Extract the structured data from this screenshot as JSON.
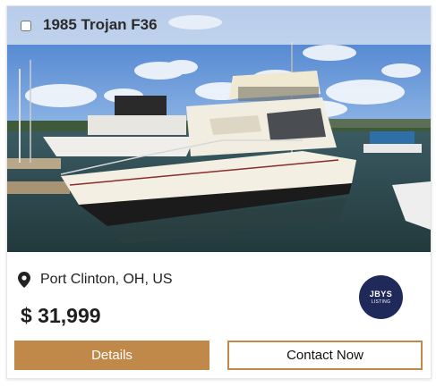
{
  "listing": {
    "title": "1985 Trojan F36",
    "location": "Port Clinton, OH, US",
    "price": "$ 31,999",
    "dealer_logo": {
      "line1": "JBYS",
      "line2": "LISTING",
      "color": "#1f2a5a"
    }
  },
  "actions": {
    "details_label": "Details",
    "contact_label": "Contact Now"
  },
  "colors": {
    "accent": "#c0894a",
    "title_bar": "#e8eef6"
  },
  "icons": {
    "location": "map-pin-icon"
  }
}
